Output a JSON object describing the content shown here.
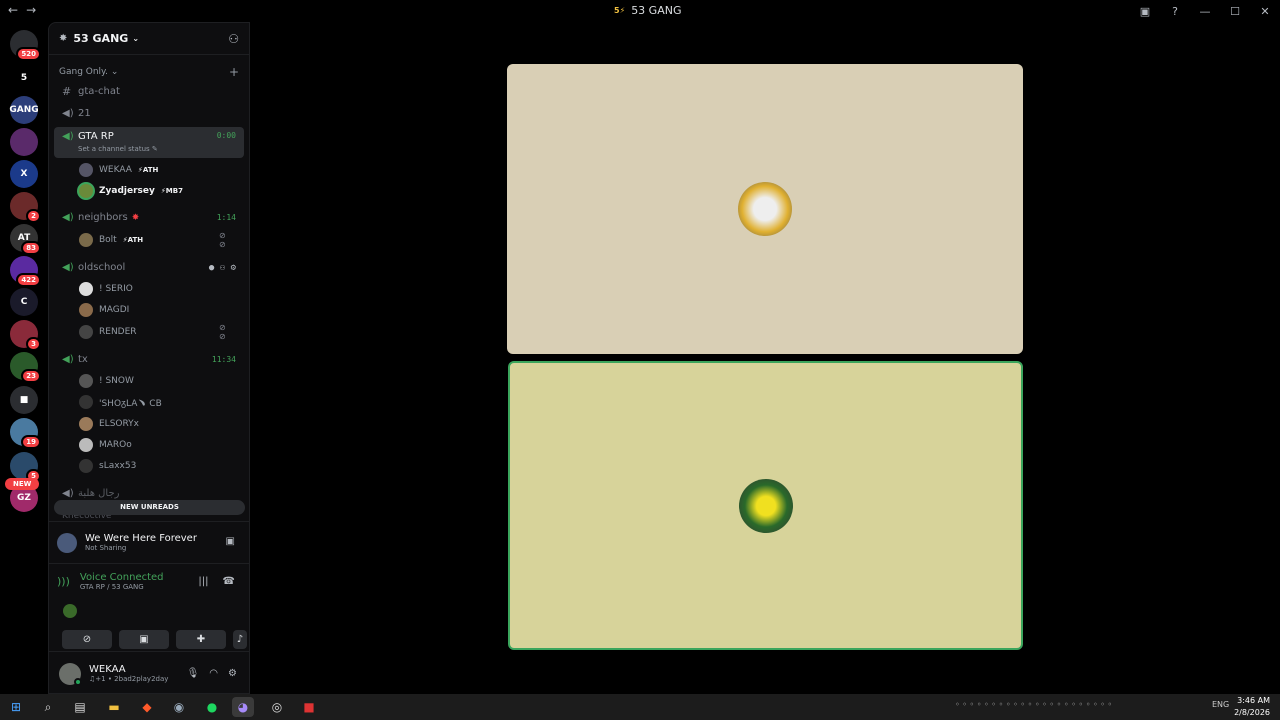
{
  "titlebar": {
    "back": "←",
    "forward": "→",
    "server_mark": "5⚡",
    "title": "53 GANG",
    "inbox_icon": "inbox-icon",
    "help": "?",
    "minimize": "—",
    "maximize": "☐",
    "close": "✕"
  },
  "servers": [
    {
      "name": "discord-home",
      "text": "",
      "color": "#2b2d31",
      "badge": "520"
    },
    {
      "name": "53-gang",
      "text": "5",
      "color": "#000",
      "badge": ""
    },
    {
      "name": "server-3",
      "text": "GANG",
      "color": "#2c3e7a",
      "badge": ""
    },
    {
      "name": "server-4",
      "text": "",
      "color": "#5a2a6a",
      "badge": ""
    },
    {
      "name": "server-5",
      "text": "X",
      "color": "#1b3a8a",
      "badge": ""
    },
    {
      "name": "server-6",
      "text": "",
      "color": "#6b2a2a",
      "badge": "2"
    },
    {
      "name": "server-7",
      "text": "AT",
      "color": "#333",
      "badge": "83"
    },
    {
      "name": "server-8",
      "text": "",
      "color": "#5a2aa0",
      "badge": "422"
    },
    {
      "name": "server-9",
      "text": "C",
      "color": "#1a1a2a",
      "badge": ""
    },
    {
      "name": "server-10",
      "text": "",
      "color": "#8a2a3a",
      "badge": "3"
    },
    {
      "name": "server-11",
      "text": "",
      "color": "#2a5a2a",
      "badge": "23"
    },
    {
      "name": "server-folder",
      "text": "■",
      "color": "#2b2d31",
      "badge": ""
    },
    {
      "name": "server-13",
      "text": "",
      "color": "#4a7aa0",
      "badge": "19"
    },
    {
      "name": "server-14",
      "text": "",
      "color": "#2a4a6a",
      "badge": "5"
    },
    {
      "name": "server-15",
      "text": "GZ",
      "color": "#a02a6a",
      "badge": ""
    }
  ],
  "new_pill": "NEW",
  "sidebar": {
    "server_name": "53 GANG",
    "category": "Gang Only.",
    "new_unreads": "NEW UNREADS",
    "faded_channel": "Knecoctive"
  },
  "channels": {
    "gta_chat": "gta-chat",
    "c21": "21",
    "gta_rp": {
      "name": "GTA RP",
      "time": "0:00",
      "status": "Set a channel status ✎"
    },
    "neighbors": {
      "name": "neighbors",
      "time": "1:14"
    },
    "oldschool": {
      "name": "oldschool"
    },
    "tx": {
      "name": "tx",
      "time": "11:34"
    },
    "arabic": "رجال هلبة"
  },
  "users": {
    "wekaa": {
      "name": "WEKAA",
      "tag": "⚡ATH"
    },
    "zyad": {
      "name": "Zyadjersey",
      "tag": "⚡MB7"
    },
    "bolt": {
      "name": "Bolt",
      "tag": "⚡ATH"
    },
    "serio": "! SERIO",
    "magdi": "MAGDI",
    "render": "RENDER",
    "snow": "! SNOW",
    "shozla": "'SHOᵹLA﹅ CB",
    "elsory": "ELSORYx",
    "maroo": "MAROo",
    "slaxx": "sLaxx53"
  },
  "activity": {
    "title": "We Were Here Forever",
    "sub": "Not Sharing"
  },
  "voice": {
    "status": "Voice Connected",
    "location": "GTA RP / 53 GANG"
  },
  "userpanel": {
    "name": "WEKAA",
    "status": "♫+1 • 2bad2play2day"
  },
  "taskbar": {
    "time": "3:46 AM",
    "date": "2/8/2026",
    "lang": "ENG"
  },
  "colors": {
    "tile1": "#d9cfb5",
    "tile2": "#d7d39a",
    "speaking": "#3ba55c",
    "accent_green": "#43a25a"
  }
}
